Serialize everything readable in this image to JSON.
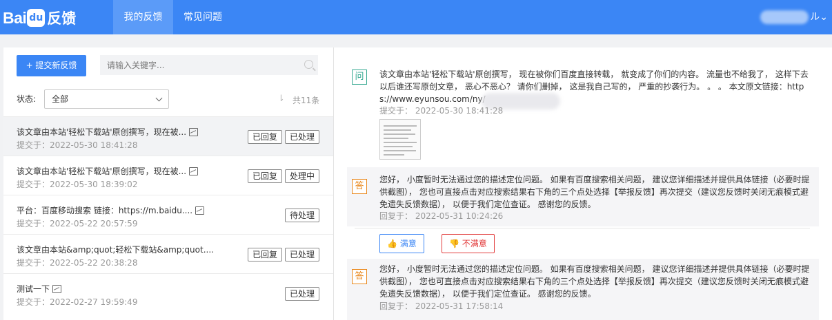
{
  "header": {
    "logo_text": "Bai",
    "logo_paw": "du",
    "logo_suffix": "反馈",
    "tabs": [
      {
        "label": "我的反馈",
        "active": true
      },
      {
        "label": "常见问题",
        "active": false
      }
    ],
    "user_suffix": "ル",
    "accent": "#3b86f5"
  },
  "left": {
    "new_button": "+ 提交新反馈",
    "search_placeholder": "请输入关键字...",
    "status_label": "状态:",
    "status_value": "全部",
    "sort_glyph": "⇂",
    "total": "共11条",
    "items": [
      {
        "title": "该文章由本站'轻松下载站'原创撰写，现在被...",
        "date": "提交于：2022-05-30 18:41:28",
        "tags": [
          "已回复",
          "已处理"
        ],
        "has_image": true
      },
      {
        "title": "该文章由本站'轻松下载站'原创撰写，现在被...",
        "date": "提交于：2022-05-30 18:39:02",
        "tags": [
          "已回复",
          "处理中"
        ],
        "has_image": true
      },
      {
        "title": "平台：百度移动搜索 链接：https://m.baidu....",
        "date": "提交于：2022-05-22 20:57:59",
        "tags": [
          "待处理"
        ],
        "has_image": true
      },
      {
        "title": "该文章由本站&amp;quot;轻松下载站&amp;quot....",
        "date": "提交于：2022-05-22 20:38:28",
        "tags": [
          "已回复",
          "已处理"
        ],
        "has_image": false
      },
      {
        "title": "测试一下",
        "date": "提交于：2022-02-27 19:59:49",
        "tags": [
          "已处理"
        ],
        "has_image": true
      }
    ]
  },
  "detail": {
    "question_mark": "问",
    "question_text": "该文章由本站'轻松下载站'原创撰写， 现在被你们百度直接转载， 就变成了你们的内容。 流量也不给我了， 这样下去以后谁还写原创文章， 恶心不恶心？ 请你们删掉， 这是我自己写的， 严重的抄袭行为。 。 。 本文原文链接：https://www.eyunsou.com/ny/",
    "question_date": "提交于： 2022-05-30 18:41:28",
    "answer_mark": "答",
    "answers": [
      {
        "text": "您好， 小度暂时无法通过您的描述定位问题。 如果有百度搜索相关问题， 建议您详细描述并提供具体链接（必要时提供截图）， 您也可直接点击对应搜索结果右下角的三个点处选择【举报反馈】再次提交（建议您反馈时关闭无痕模式避免遗失反馈数据）， 以便于我们定位查证。 感谢您的反馈。",
        "date": "回复于： 2022-05-31 10:24:26"
      },
      {
        "text": "您好， 小度暂时无法通过您的描述定位问题。 如果有百度搜索相关问题， 建议您详细描述并提供具体链接（必要时提供截图）， 您也可直接点击对应搜索结果右下角的三个点处选择【举报反馈】再次提交（建议您反馈时关闭无痕模式避免遗失反馈数据）， 以便于我们定位查证。 感谢您的反馈。",
        "date": "回复于： 2022-05-31 17:58:14"
      }
    ],
    "satisfied": "满意",
    "unsatisfied": "不满意"
  }
}
